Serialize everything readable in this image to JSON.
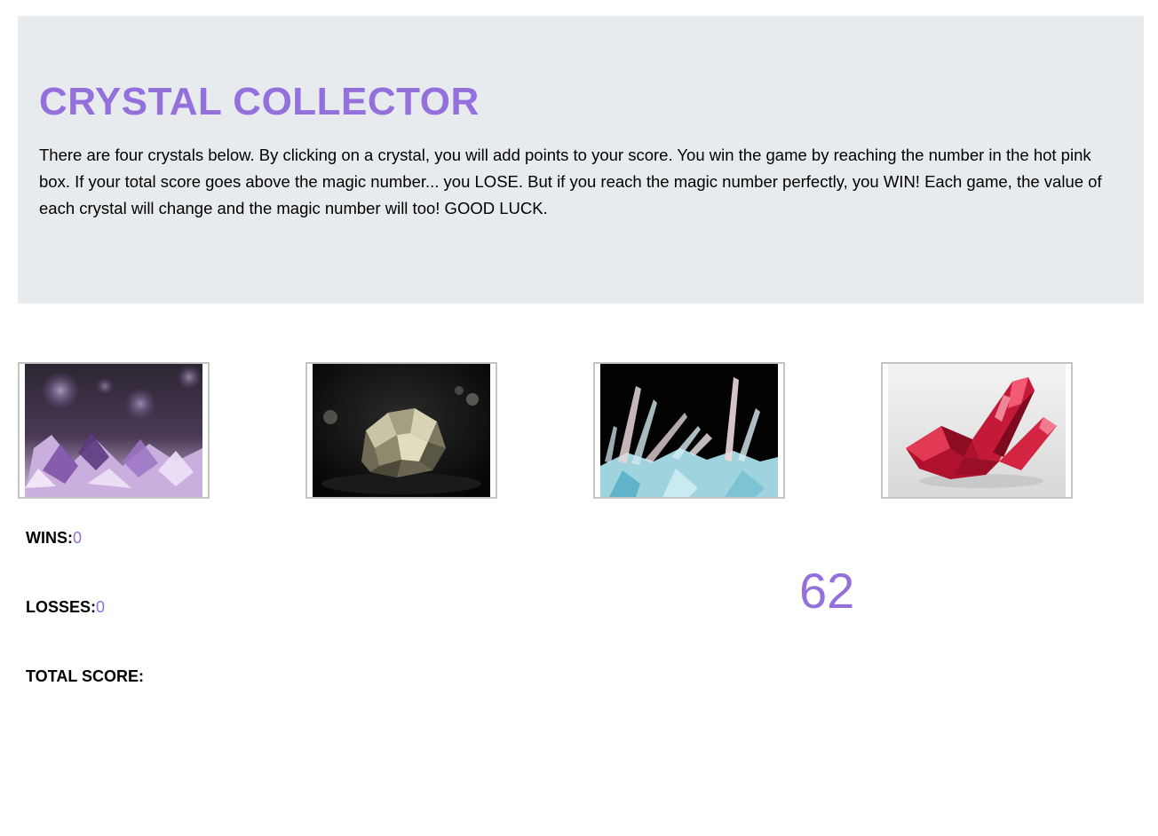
{
  "header": {
    "title": "CRYSTAL COLLECTOR",
    "instructions": "There are four crystals below. By clicking on a crystal, you will add points to your score. You win the game by reaching the number in the hot pink box. If your total score goes above the magic number... you LOSE. But if you reach the magic number perfectly, you WIN! Each game, the value of each crystal will change and the magic number will too! GOOD LUCK."
  },
  "crystals": [
    {
      "name": "amethyst",
      "icon": "amethyst-crystal-image"
    },
    {
      "name": "pyrite",
      "icon": "pyrite-crystal-image"
    },
    {
      "name": "clear-blue",
      "icon": "clear-blue-crystal-image"
    },
    {
      "name": "ruby",
      "icon": "ruby-crystal-image"
    }
  ],
  "stats": {
    "wins_label": "WINS:",
    "wins_value": "0",
    "losses_label": "LOSSES:",
    "losses_value": "0",
    "total_label": "TOTAL SCORE:",
    "total_value": ""
  },
  "magic_number": "62",
  "colors": {
    "accent": "#9370db",
    "jumbotron_bg": "#e8ebee"
  }
}
